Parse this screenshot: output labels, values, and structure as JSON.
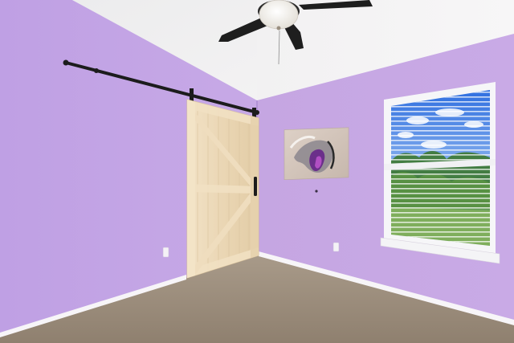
{
  "scene": {
    "subject": "empty-room",
    "colors": {
      "left_wall": "#c4a4e6",
      "back_wall": "#c7a8e5",
      "ceiling": "#f1f0f1",
      "carpet": "#9c8d7c",
      "barn_door": "#ecd9b9",
      "rail": "#1c1c1c",
      "baseboard": "#f7f5f8",
      "window_frame": "#f6f6f8",
      "sky": "#3f7ee3",
      "fan_blade": "#1e1e1e",
      "fan_light": "#f4f1ea"
    }
  }
}
